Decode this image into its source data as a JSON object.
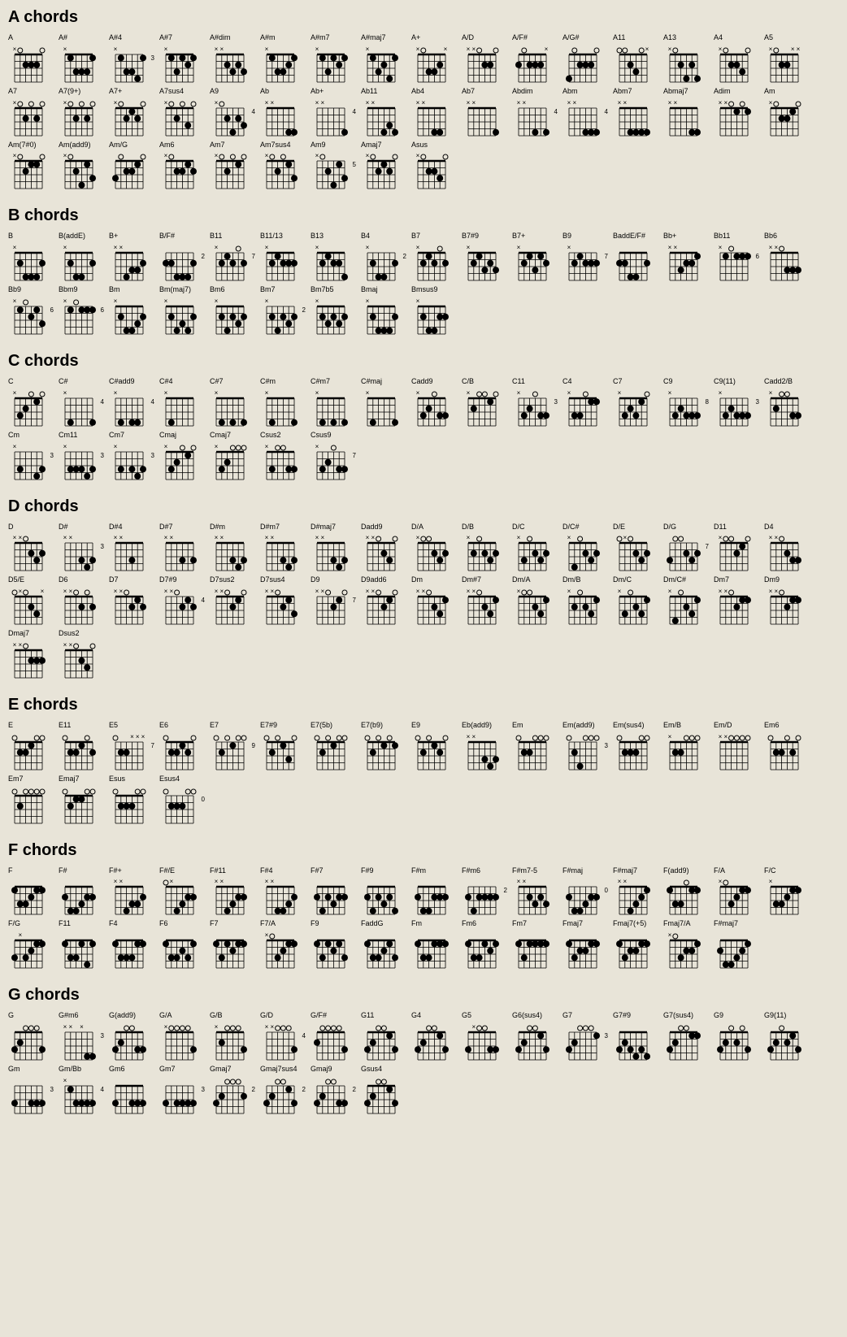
{
  "sections": [
    {
      "id": "A",
      "title": "A chords",
      "chords": [
        {
          "name": "A",
          "fingers": "x02220"
        },
        {
          "name": "A#",
          "fingers": "x13331"
        },
        {
          "name": "A#4",
          "fingers": "x13341",
          "fret": "3"
        },
        {
          "name": "A#7",
          "fingers": "x13121"
        },
        {
          "name": "A#dim",
          "fingers": "xx2323"
        },
        {
          "name": "A#m",
          "fingers": "x13321"
        },
        {
          "name": "A#m7",
          "fingers": "x13121"
        },
        {
          "name": "A#maj7",
          "fingers": "x13241"
        },
        {
          "name": "A+",
          "fingers": "x0332x"
        },
        {
          "name": "A/D",
          "fingers": "xx0220"
        },
        {
          "name": "A/F#",
          "fingers": "20222x"
        },
        {
          "name": "A/G#",
          "fingers": "402220"
        },
        {
          "name": "A11",
          "fingers": "00230x"
        },
        {
          "name": "A13",
          "fingers": "x02424"
        },
        {
          "name": "A4",
          "fingers": "x02230"
        },
        {
          "name": "A5",
          "fingers": "x022xx"
        },
        {
          "name": "A7",
          "fingers": "x02020"
        },
        {
          "name": "A7(9+)",
          "fingers": "x02020"
        },
        {
          "name": "A7+",
          "fingers": "x02120"
        },
        {
          "name": "A7sus4",
          "fingers": "x02030"
        },
        {
          "name": "A9",
          "fingers": "x02423",
          "fret": "4"
        },
        {
          "name": "Ab",
          "fingers": "xx6544"
        },
        {
          "name": "Ab+",
          "fingers": "xx6554",
          "fret": "4"
        },
        {
          "name": "Ab11",
          "fingers": "xx6434"
        },
        {
          "name": "Ab4",
          "fingers": "xx6446"
        },
        {
          "name": "Ab7",
          "fingers": "xx6564"
        },
        {
          "name": "Abdim",
          "fingers": "xx5454",
          "fret": "4"
        },
        {
          "name": "Abm",
          "fingers": "xx6444",
          "fret": "4"
        },
        {
          "name": "Abm7",
          "fingers": "xx4444"
        },
        {
          "name": "Abmaj7",
          "fingers": "xx6544"
        },
        {
          "name": "Adim",
          "fingers": "xx0101"
        },
        {
          "name": "Am",
          "fingers": "x02210"
        },
        {
          "name": "Am(7#0)",
          "fingers": "x02110"
        },
        {
          "name": "Am(add9)",
          "fingers": "x02413"
        },
        {
          "name": "Am/G",
          "fingers": "302210"
        },
        {
          "name": "Am6",
          "fingers": "x02212"
        },
        {
          "name": "Am7",
          "fingers": "x02010"
        },
        {
          "name": "Am7sus4",
          "fingers": "x02013"
        },
        {
          "name": "Am9",
          "fingers": "x02413",
          "fret": "5"
        },
        {
          "name": "Amaj7",
          "fingers": "x02120"
        },
        {
          "name": "Asus",
          "fingers": "x02230"
        }
      ]
    },
    {
      "id": "B",
      "title": "B chords",
      "chords": [
        {
          "name": "B",
          "fingers": "x24442"
        },
        {
          "name": "B(addE)",
          "fingers": "x24452"
        },
        {
          "name": "B+",
          "fingers": "xx4332"
        },
        {
          "name": "B/F#",
          "fingers": "224442",
          "fret": "2"
        },
        {
          "name": "B11",
          "fingers": "x21202",
          "fret": "7"
        },
        {
          "name": "B11/13",
          "fingers": "x21222"
        },
        {
          "name": "B13",
          "fingers": "x21224"
        },
        {
          "name": "B4",
          "fingers": "x24452",
          "fret": "2"
        },
        {
          "name": "B7",
          "fingers": "x21202"
        },
        {
          "name": "B7#9",
          "fingers": "x21323"
        },
        {
          "name": "B7+",
          "fingers": "x21312"
        },
        {
          "name": "B9",
          "fingers": "x21222",
          "fret": "7"
        },
        {
          "name": "BaddE/F#",
          "fingers": "224452"
        },
        {
          "name": "Bb+",
          "fingers": "xx3221"
        },
        {
          "name": "Bb11",
          "fingers": "x10111",
          "fret": "6"
        },
        {
          "name": "Bb6",
          "fingers": "xx0333"
        },
        {
          "name": "Bb9",
          "fingers": "x10213",
          "fret": "6"
        },
        {
          "name": "Bbm9",
          "fingers": "x10111",
          "fret": "6"
        },
        {
          "name": "Bm",
          "fingers": "x24432"
        },
        {
          "name": "Bm(maj7)",
          "fingers": "x24342"
        },
        {
          "name": "Bm6",
          "fingers": "x24232"
        },
        {
          "name": "Bm7",
          "fingers": "x24232",
          "fret": "2"
        },
        {
          "name": "Bm7b5",
          "fingers": "x23232"
        },
        {
          "name": "Bmaj",
          "fingers": "x24442"
        },
        {
          "name": "Bmsus9",
          "fingers": "x24422"
        }
      ]
    },
    {
      "id": "C",
      "title": "C chords",
      "chords": [
        {
          "name": "C",
          "fingers": "x32010"
        },
        {
          "name": "C#",
          "fingers": "x46664",
          "fret": "4"
        },
        {
          "name": "C#add9",
          "fingers": "x46446",
          "fret": "4"
        },
        {
          "name": "C#4",
          "fingers": "x46676"
        },
        {
          "name": "C#7",
          "fingers": "x46464"
        },
        {
          "name": "C#m",
          "fingers": "x46654"
        },
        {
          "name": "C#m7",
          "fingers": "x46454"
        },
        {
          "name": "C#maj",
          "fingers": "x46664"
        },
        {
          "name": "Cadd9",
          "fingers": "x32033"
        },
        {
          "name": "C/B",
          "fingers": "x20010"
        },
        {
          "name": "C11",
          "fingers": "x32033",
          "fret": "3"
        },
        {
          "name": "C4",
          "fingers": "x33011"
        },
        {
          "name": "C7",
          "fingers": "x32310"
        },
        {
          "name": "C9",
          "fingers": "x32333",
          "fret": "8"
        },
        {
          "name": "C9(11)",
          "fingers": "x32333",
          "fret": "3"
        },
        {
          "name": "Cadd2/B",
          "fingers": "x20033"
        },
        {
          "name": "Cm",
          "fingers": "x35543",
          "fret": "3"
        },
        {
          "name": "Cm11",
          "fingers": "x33343",
          "fret": "3"
        },
        {
          "name": "Cm7",
          "fingers": "x35343",
          "fret": "3"
        },
        {
          "name": "Cmaj",
          "fingers": "x32010"
        },
        {
          "name": "Cmaj7",
          "fingers": "x32000"
        },
        {
          "name": "Csus2",
          "fingers": "x30033"
        },
        {
          "name": "Csus9",
          "fingers": "x32033",
          "fret": "7"
        }
      ]
    },
    {
      "id": "D",
      "title": "D chords",
      "chords": [
        {
          "name": "D",
          "fingers": "xx0232"
        },
        {
          "name": "D#",
          "fingers": "xx5343",
          "fret": "3"
        },
        {
          "name": "D#4",
          "fingers": "xx5365"
        },
        {
          "name": "D#7",
          "fingers": "xx5363"
        },
        {
          "name": "D#m",
          "fingers": "xx5343"
        },
        {
          "name": "D#m7",
          "fingers": "xx5343"
        },
        {
          "name": "D#maj7",
          "fingers": "xx5343"
        },
        {
          "name": "Dadd9",
          "fingers": "xx0230"
        },
        {
          "name": "D/A",
          "fingers": "x00232"
        },
        {
          "name": "D/B",
          "fingers": "x20232"
        },
        {
          "name": "D/C",
          "fingers": "x30232"
        },
        {
          "name": "D/C#",
          "fingers": "x40232"
        },
        {
          "name": "D/E",
          "fingers": "0x0232"
        },
        {
          "name": "D/G",
          "fingers": "300232",
          "fret": "7"
        },
        {
          "name": "D11",
          "fingers": "x00210"
        },
        {
          "name": "D4",
          "fingers": "xx0233"
        },
        {
          "name": "D5/E",
          "fingers": "0x023x"
        },
        {
          "name": "D6",
          "fingers": "xx0202"
        },
        {
          "name": "D7",
          "fingers": "xx0212"
        },
        {
          "name": "D7#9",
          "fingers": "xx0212",
          "fret": "4"
        },
        {
          "name": "D7sus2",
          "fingers": "xx0210"
        },
        {
          "name": "D7sus4",
          "fingers": "xx0213"
        },
        {
          "name": "D9",
          "fingers": "xx0210",
          "fret": "7"
        },
        {
          "name": "D9add6",
          "fingers": "xx0210"
        },
        {
          "name": "Dm",
          "fingers": "xx0231"
        },
        {
          "name": "Dm#7",
          "fingers": "xx0231"
        },
        {
          "name": "Dm/A",
          "fingers": "x00231"
        },
        {
          "name": "Dm/B",
          "fingers": "x20231"
        },
        {
          "name": "Dm/C",
          "fingers": "x30231"
        },
        {
          "name": "Dm/C#",
          "fingers": "x40231"
        },
        {
          "name": "Dm7",
          "fingers": "xx0211"
        },
        {
          "name": "Dm9",
          "fingers": "xx0211"
        },
        {
          "name": "Dmaj7",
          "fingers": "xx0222"
        },
        {
          "name": "Dsus2",
          "fingers": "xx0230"
        }
      ]
    },
    {
      "id": "E",
      "title": "E chords",
      "chords": [
        {
          "name": "E",
          "fingers": "022100"
        },
        {
          "name": "E11",
          "fingers": "022102"
        },
        {
          "name": "E5",
          "fingers": "022xxx",
          "fret": "7"
        },
        {
          "name": "E6",
          "fingers": "022120"
        },
        {
          "name": "E7",
          "fingers": "020100",
          "fret": "9"
        },
        {
          "name": "E7#9",
          "fingers": "020130"
        },
        {
          "name": "E7(5b)",
          "fingers": "020100"
        },
        {
          "name": "E7(b9)",
          "fingers": "020101"
        },
        {
          "name": "E9",
          "fingers": "020120"
        },
        {
          "name": "Eb(add9)",
          "fingers": "xx5343"
        },
        {
          "name": "Em",
          "fingers": "022000"
        },
        {
          "name": "Em(add9)",
          "fingers": "024000",
          "fret": "3"
        },
        {
          "name": "Em(sus4)",
          "fingers": "022200"
        },
        {
          "name": "Em/B",
          "fingers": "x22000"
        },
        {
          "name": "Em/D",
          "fingers": "xx0000"
        },
        {
          "name": "Em6",
          "fingers": "022020"
        },
        {
          "name": "Em7",
          "fingers": "020000"
        },
        {
          "name": "Emaj7",
          "fingers": "021100"
        },
        {
          "name": "Esus",
          "fingers": "022200"
        },
        {
          "name": "Esus4",
          "fingers": "022200",
          "fret": "0"
        }
      ]
    },
    {
      "id": "F",
      "title": "F chords",
      "chords": [
        {
          "name": "F",
          "fingers": "133211"
        },
        {
          "name": "F#",
          "fingers": "244322"
        },
        {
          "name": "F#+",
          "fingers": "xx4332"
        },
        {
          "name": "F#/E",
          "fingers": "0x4322"
        },
        {
          "name": "F#11",
          "fingers": "xx4322"
        },
        {
          "name": "F#4",
          "fingers": "xx4432"
        },
        {
          "name": "F#7",
          "fingers": "242322"
        },
        {
          "name": "F#9",
          "fingers": "242324"
        },
        {
          "name": "F#m",
          "fingers": "244222"
        },
        {
          "name": "F#m6",
          "fingers": "242222",
          "fret": "2"
        },
        {
          "name": "F#m7-5",
          "fingers": "xx2323"
        },
        {
          "name": "F#maj",
          "fingers": "244322",
          "fret": "0"
        },
        {
          "name": "F#maj7",
          "fingers": "xx4321"
        },
        {
          "name": "F(add9)",
          "fingers": "133011"
        },
        {
          "name": "F/A",
          "fingers": "x03211"
        },
        {
          "name": "F/C",
          "fingers": "x33211"
        },
        {
          "name": "F/G",
          "fingers": "3x3211"
        },
        {
          "name": "F11",
          "fingers": "133141"
        },
        {
          "name": "F4",
          "fingers": "133311"
        },
        {
          "name": "F6",
          "fingers": "133231"
        },
        {
          "name": "F7",
          "fingers": "131211"
        },
        {
          "name": "F7/A",
          "fingers": "x03211"
        },
        {
          "name": "F9",
          "fingers": "131213"
        },
        {
          "name": "FaddG",
          "fingers": "133213"
        },
        {
          "name": "Fm",
          "fingers": "133111"
        },
        {
          "name": "Fm6",
          "fingers": "133121"
        },
        {
          "name": "Fm7",
          "fingers": "131111"
        },
        {
          "name": "Fmaj7",
          "fingers": "132211"
        },
        {
          "name": "Fmaj7(+5)",
          "fingers": "132211"
        },
        {
          "name": "Fmaj7/A",
          "fingers": "x03221"
        },
        {
          "name": "F#maj7",
          "fingers": "244321"
        }
      ]
    },
    {
      "id": "G",
      "title": "G chords",
      "chords": [
        {
          "name": "G",
          "fingers": "320003"
        },
        {
          "name": "G#m6",
          "fingers": "xx6x44",
          "fret": "3"
        },
        {
          "name": "G(add9)",
          "fingers": "320033"
        },
        {
          "name": "G/A",
          "fingers": "x00003"
        },
        {
          "name": "G/B",
          "fingers": "x20003"
        },
        {
          "name": "G/D",
          "fingers": "xx0003",
          "fret": "4"
        },
        {
          "name": "G/F#",
          "fingers": "200003"
        },
        {
          "name": "G11",
          "fingers": "320013"
        },
        {
          "name": "G4",
          "fingers": "320013"
        },
        {
          "name": "G5",
          "fingers": "3x0033"
        },
        {
          "name": "G6(sus4)",
          "fingers": "320013"
        },
        {
          "name": "G7",
          "fingers": "320001",
          "fret": "3"
        },
        {
          "name": "G7#9",
          "fingers": "323434"
        },
        {
          "name": "G7(sus4)",
          "fingers": "320011"
        },
        {
          "name": "G9",
          "fingers": "320203"
        },
        {
          "name": "G9(11)",
          "fingers": "320213"
        },
        {
          "name": "Gm",
          "fingers": "355333",
          "fret": "3"
        },
        {
          "name": "Gm/Bb",
          "fingers": "x13333",
          "fret": "4"
        },
        {
          "name": "Gm6",
          "fingers": "355333"
        },
        {
          "name": "Gm7",
          "fingers": "353333",
          "fret": "3"
        },
        {
          "name": "Gmaj7",
          "fingers": "320002",
          "fret": "2"
        },
        {
          "name": "Gmaj7sus4",
          "fingers": "320013",
          "fret": "2"
        },
        {
          "name": "Gmaj9",
          "fingers": "320033",
          "fret": "2"
        },
        {
          "name": "Gsus4",
          "fingers": "320013"
        }
      ]
    }
  ]
}
